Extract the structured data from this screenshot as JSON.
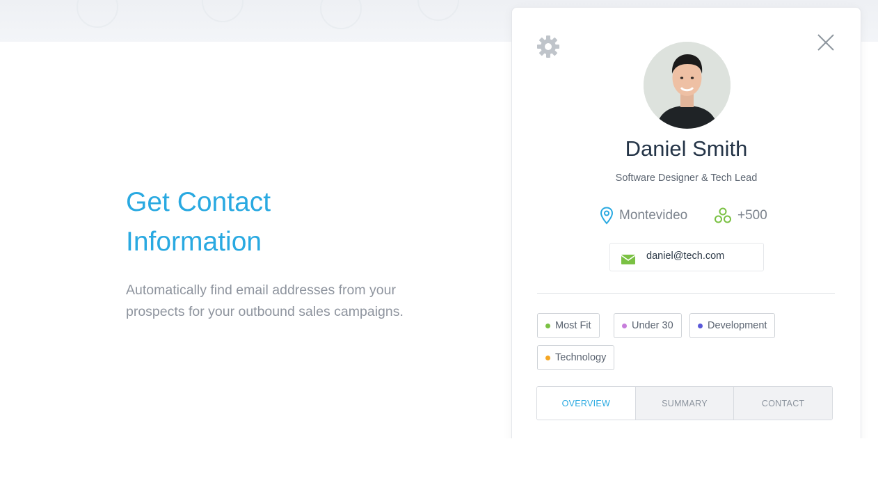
{
  "hero": {
    "title_line1": "Get Contact",
    "title_line2": "Information",
    "description": "Automatically find email addresses from your prospects for your outbound sales campaigns."
  },
  "profile": {
    "name": "Daniel Smith",
    "role": "Software Designer & Tech Lead",
    "location": "Montevideo",
    "connections": "+500",
    "email": "daniel@tech.com"
  },
  "tags": [
    {
      "label": "Most Fit",
      "color": "#7ac143"
    },
    {
      "label": "Under 30",
      "color": "#c77ddb"
    },
    {
      "label": "Development",
      "color": "#5a58d8"
    },
    {
      "label": "Technology",
      "color": "#f5a623"
    }
  ],
  "tabs": [
    {
      "label": "OVERVIEW",
      "active": true
    },
    {
      "label": "SUMMARY",
      "active": false
    },
    {
      "label": "CONTACT",
      "active": false
    }
  ],
  "icons": {
    "settings": "gear-icon",
    "close": "close-icon",
    "location": "map-pin-icon",
    "connections": "network-icon",
    "email": "envelope-icon"
  },
  "colors": {
    "accent": "#29a9e1",
    "green": "#7ac143"
  }
}
